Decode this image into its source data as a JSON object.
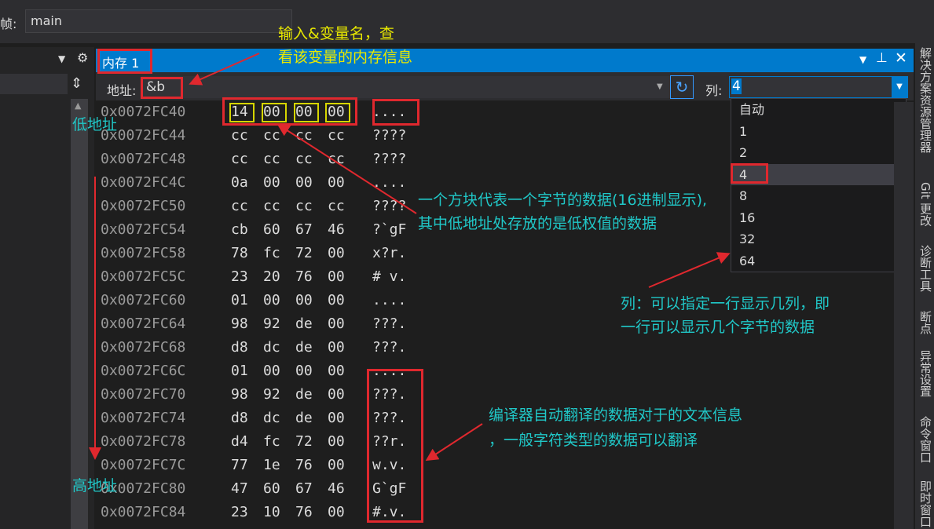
{
  "top": {
    "frame_label": "帧:",
    "frame_value": "main"
  },
  "memory_window": {
    "title": "内存 1",
    "address_label": "地址:",
    "address_value": "&b",
    "columns_label": "列:",
    "columns_value": "4",
    "columns_options": [
      "自动",
      "1",
      "2",
      "4",
      "8",
      "16",
      "32",
      "64"
    ],
    "rows": [
      {
        "addr": "0x0072FC40",
        "bytes": [
          "14",
          "00",
          "00",
          "00"
        ],
        "ascii": "...."
      },
      {
        "addr": "0x0072FC44",
        "bytes": [
          "cc",
          "cc",
          "cc",
          "cc"
        ],
        "ascii": "????"
      },
      {
        "addr": "0x0072FC48",
        "bytes": [
          "cc",
          "cc",
          "cc",
          "cc"
        ],
        "ascii": "????"
      },
      {
        "addr": "0x0072FC4C",
        "bytes": [
          "0a",
          "00",
          "00",
          "00"
        ],
        "ascii": "...."
      },
      {
        "addr": "0x0072FC50",
        "bytes": [
          "cc",
          "cc",
          "cc",
          "cc"
        ],
        "ascii": "????"
      },
      {
        "addr": "0x0072FC54",
        "bytes": [
          "cb",
          "60",
          "67",
          "46"
        ],
        "ascii": "?`gF"
      },
      {
        "addr": "0x0072FC58",
        "bytes": [
          "78",
          "fc",
          "72",
          "00"
        ],
        "ascii": "x?r."
      },
      {
        "addr": "0x0072FC5C",
        "bytes": [
          "23",
          "20",
          "76",
          "00"
        ],
        "ascii": "# v."
      },
      {
        "addr": "0x0072FC60",
        "bytes": [
          "01",
          "00",
          "00",
          "00"
        ],
        "ascii": "...."
      },
      {
        "addr": "0x0072FC64",
        "bytes": [
          "98",
          "92",
          "de",
          "00"
        ],
        "ascii": "???."
      },
      {
        "addr": "0x0072FC68",
        "bytes": [
          "d8",
          "dc",
          "de",
          "00"
        ],
        "ascii": "???."
      },
      {
        "addr": "0x0072FC6C",
        "bytes": [
          "01",
          "00",
          "00",
          "00"
        ],
        "ascii": "...."
      },
      {
        "addr": "0x0072FC70",
        "bytes": [
          "98",
          "92",
          "de",
          "00"
        ],
        "ascii": "???."
      },
      {
        "addr": "0x0072FC74",
        "bytes": [
          "d8",
          "dc",
          "de",
          "00"
        ],
        "ascii": "???."
      },
      {
        "addr": "0x0072FC78",
        "bytes": [
          "d4",
          "fc",
          "72",
          "00"
        ],
        "ascii": "??r."
      },
      {
        "addr": "0x0072FC7C",
        "bytes": [
          "77",
          "1e",
          "76",
          "00"
        ],
        "ascii": "w.v."
      },
      {
        "addr": "0x0072FC80",
        "bytes": [
          "47",
          "60",
          "67",
          "46"
        ],
        "ascii": "G`gF"
      },
      {
        "addr": "0x0072FC84",
        "bytes": [
          "23",
          "10",
          "76",
          "00"
        ],
        "ascii": "#.v."
      }
    ]
  },
  "annotations": {
    "input_hint_1": "输入&变量名，查",
    "input_hint_2": "看该变量的内存信息",
    "low_addr": "低地址",
    "high_addr": "高地址",
    "byte_hint_1": "一个方块代表一个字节的数据(16进制显示),",
    "byte_hint_2": "其中低地址处存放的是低权值的数据",
    "col_hint_1": "列：可以指定一行显示几列，即",
    "col_hint_2": "一行可以显示几个字节的数据",
    "text_hint_1": "编译器自动翻译的数据对于的文本信息",
    "text_hint_2": "，一般字符类型的数据可以翻译"
  },
  "side_tabs": [
    "解决方案资源管理器",
    "Git 更改",
    "诊断工具",
    "断点",
    "异常设置",
    "命令窗口",
    "即时窗口"
  ]
}
